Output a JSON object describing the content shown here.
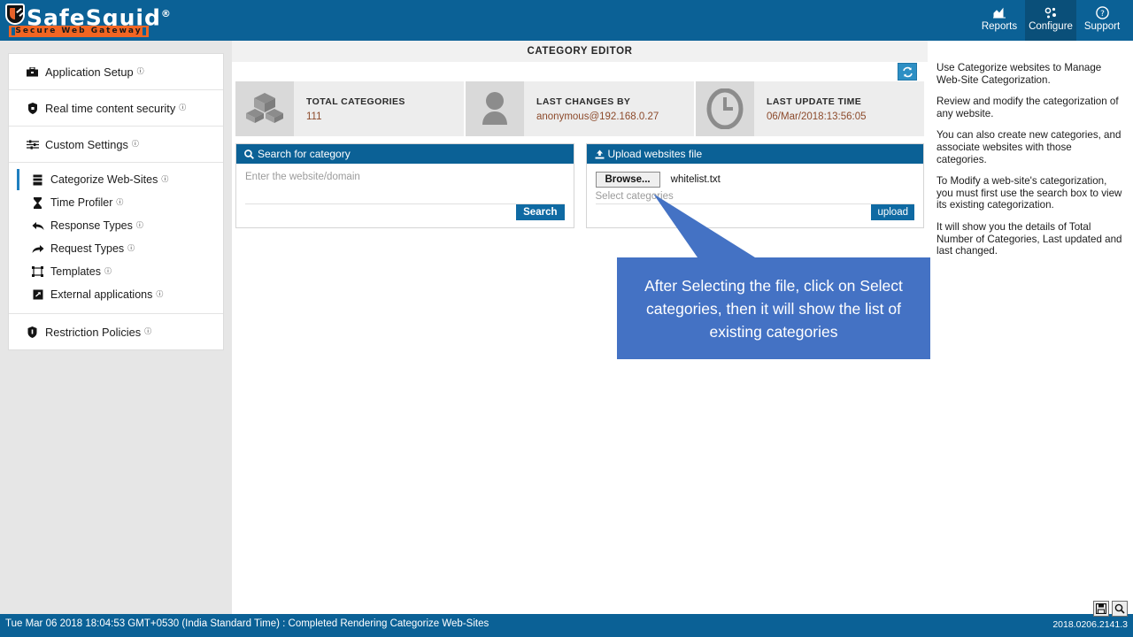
{
  "header": {
    "brand": "SafeSquid",
    "brand_reg": "®",
    "tagline": "Secure Web Gateway",
    "nav": [
      {
        "label": "Reports",
        "icon": "reports-chart-icon",
        "active": false
      },
      {
        "label": "Configure",
        "icon": "configure-gear-icon",
        "active": true
      },
      {
        "label": "Support",
        "icon": "support-question-icon",
        "active": false
      }
    ]
  },
  "sidebar": {
    "groups": [
      {
        "items": [
          {
            "label": "Application Setup",
            "icon": "briefcase-icon",
            "info": "ⓘ",
            "active": false
          }
        ]
      },
      {
        "items": [
          {
            "label": "Real time content security",
            "icon": "shield-lock-icon",
            "info": "ⓘ",
            "active": false
          }
        ]
      },
      {
        "items": [
          {
            "label": "Custom Settings",
            "icon": "sliders-icon",
            "info": "ⓘ",
            "active": false
          }
        ]
      },
      {
        "items": [
          {
            "label": "Categorize Web-Sites",
            "icon": "database-icon",
            "info": "ⓘ",
            "active": true
          },
          {
            "label": "Time Profiler",
            "icon": "hourglass-icon",
            "info": "ⓘ",
            "active": false
          },
          {
            "label": "Response Types",
            "icon": "arrow-reply-icon",
            "info": "ⓘ",
            "active": false
          },
          {
            "label": "Request Types",
            "icon": "arrow-forward-icon",
            "info": "ⓘ",
            "active": false
          },
          {
            "label": "Templates",
            "icon": "templates-icon",
            "info": "ⓘ",
            "active": false
          },
          {
            "label": "External applications",
            "icon": "external-app-icon",
            "info": "ⓘ",
            "active": false
          }
        ]
      },
      {
        "items": [
          {
            "label": "Restriction Policies",
            "icon": "shield-icon",
            "info": "ⓘ",
            "active": false
          }
        ]
      }
    ]
  },
  "main": {
    "page_title": "CATEGORY EDITOR",
    "refresh_icon": "refresh-icon",
    "stats": [
      {
        "icon": "cubes-icon",
        "label": "TOTAL CATEGORIES",
        "value": "111"
      },
      {
        "icon": "user-icon",
        "label": "LAST CHANGES BY",
        "value": "anonymous@192.168.0.27"
      },
      {
        "icon": "clock-icon",
        "label": "LAST UPDATE TIME",
        "value": "06/Mar/2018:13:56:05"
      }
    ],
    "search_panel": {
      "title": "Search for category",
      "icon": "search-icon",
      "placeholder": "Enter the website/domain",
      "value": "",
      "button": "Search"
    },
    "upload_panel": {
      "title": "Upload websites file",
      "icon": "upload-icon",
      "browse_label": "Browse...",
      "filename": "whitelist.txt",
      "categories_placeholder": "Select categories",
      "button": "upload"
    }
  },
  "help": {
    "paragraphs": [
      "Use Categorize websites to Manage Web-Site Categorization.",
      "Review and modify the categorization of any website.",
      "You can also create new categories, and associate websites with those categories.",
      "To Modify a web-site's categorization, you must first use the search box to view its existing categorization.",
      "It will show you the details of Total Number of Categories, Last updated and last changed."
    ]
  },
  "callout": {
    "text": "After Selecting the file, click on Select categories, then it will show the list of existing categories",
    "color": "#4472c4"
  },
  "footer": {
    "status": "Tue Mar 06 2018 18:04:53 GMT+0530 (India Standard Time) : Completed Rendering Categorize Web-Sites",
    "version": "2018.0206.2141.3",
    "icons": [
      {
        "name": "save-icon"
      },
      {
        "name": "search-icon"
      }
    ]
  },
  "colors": {
    "brand_blue": "#0b6196",
    "accent_orange": "#f26522",
    "stat_value": "#8c4a2b",
    "callout_blue": "#4472c4"
  }
}
